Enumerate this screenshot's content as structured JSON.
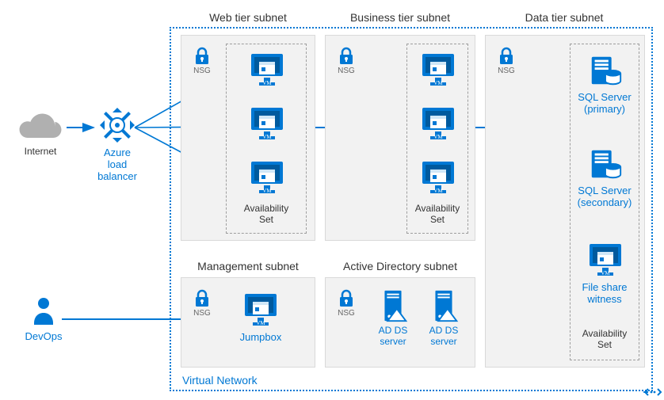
{
  "external": {
    "internet_label": "Internet",
    "devops_label": "DevOps"
  },
  "load_balancers": {
    "lb1_label": "Azure load\nbalancer",
    "lb2_label": "Azure load\nbalancer",
    "lb3_label": "Azure load\nbalancer"
  },
  "vnet": {
    "label": "Virtual Network"
  },
  "subnets": {
    "web": {
      "title": "Web tier subnet",
      "nsg_label": "NSG",
      "availability_set_label": "Availability\nSet",
      "vm_caption": "VM"
    },
    "business": {
      "title": "Business tier subnet",
      "nsg_label": "NSG",
      "availability_set_label": "Availability\nSet",
      "vm_caption": "VM"
    },
    "data": {
      "title": "Data tier subnet",
      "nsg_label": "NSG",
      "availability_set_label": "Availability\nSet",
      "sql_primary_label": "SQL Server\n(primary)",
      "sql_secondary_label": "SQL Server\n(secondary)",
      "file_share_label": "File share\nwitness",
      "vm_caption": "VM"
    },
    "management": {
      "title": "Management subnet",
      "nsg_label": "NSG",
      "jumpbox_label": "Jumpbox",
      "vm_caption": "VM"
    },
    "ad": {
      "title": "Active Directory subnet",
      "nsg_label": "NSG",
      "ad_server_label1": "AD DS\nserver",
      "ad_server_label2": "AD DS\nserver"
    }
  },
  "colors": {
    "azure_blue": "#0078d4",
    "azure_blue_dark": "#005a9e",
    "grey_bg": "#f2f2f2",
    "cloud_grey": "#b0b0b0"
  }
}
